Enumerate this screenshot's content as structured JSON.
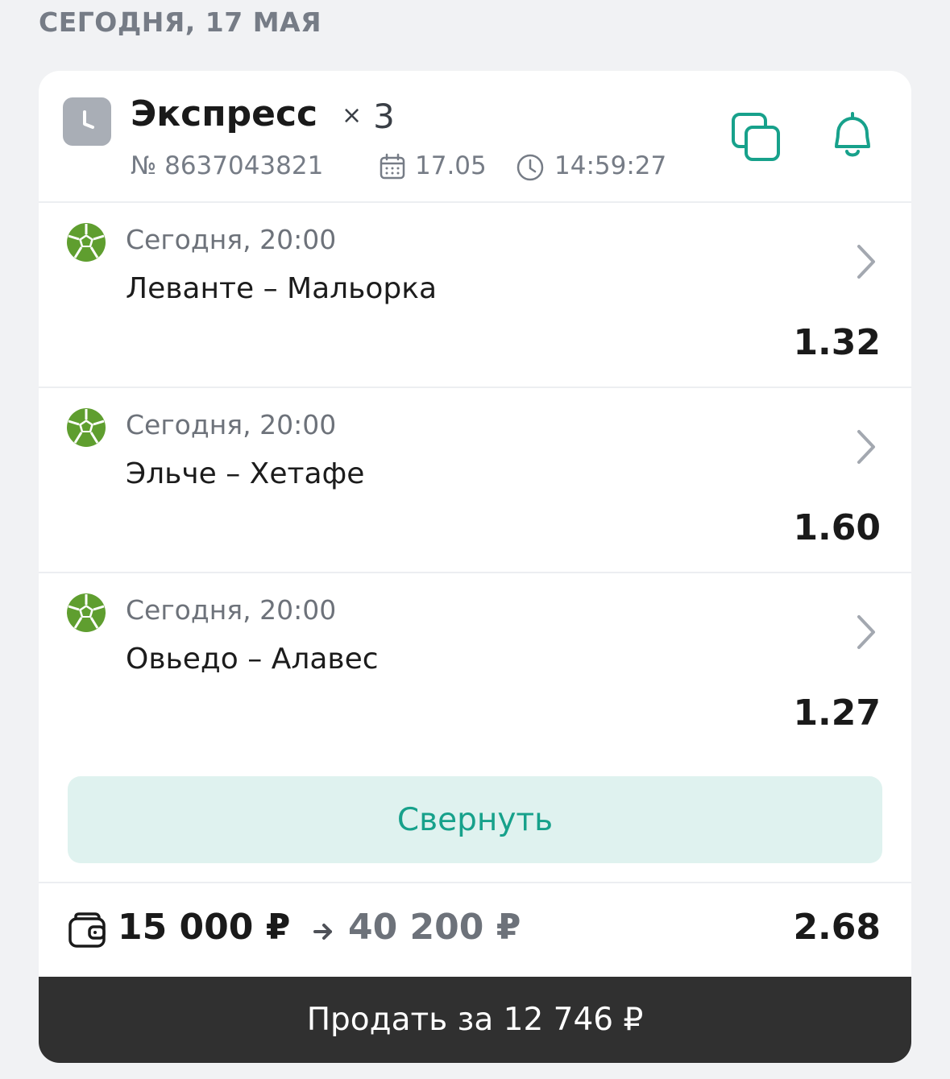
{
  "date_header": "СЕГОДНЯ, 17 МАЯ",
  "bet": {
    "type": "Экспресс",
    "multiplier_sign": "×",
    "multiplier": "3",
    "number": "№ 8637043821",
    "date": "17.05",
    "time": "14:59:27",
    "status_icon": "clock-icon",
    "colors": {
      "accent": "#17a18b",
      "badge": "#a9aeb6"
    }
  },
  "header_actions": {
    "copy_icon": "copy-icon",
    "bell_icon": "bell-icon"
  },
  "events": [
    {
      "sport_icon": "football-icon",
      "time": "Сегодня, 20:00",
      "teams": "Леванте – Мальорка",
      "odds": "1.32"
    },
    {
      "sport_icon": "football-icon",
      "time": "Сегодня, 20:00",
      "teams": "Эльче – Хетафе",
      "odds": "1.60"
    },
    {
      "sport_icon": "football-icon",
      "time": "Сегодня, 20:00",
      "teams": "Овьедо – Алавес",
      "odds": "1.27"
    }
  ],
  "collapse_label": "Свернуть",
  "summary": {
    "stake": "15 000 ₽",
    "payout": "40 200 ₽",
    "total_odds": "2.68"
  },
  "sell_label": "Продать за 12 746 ₽"
}
